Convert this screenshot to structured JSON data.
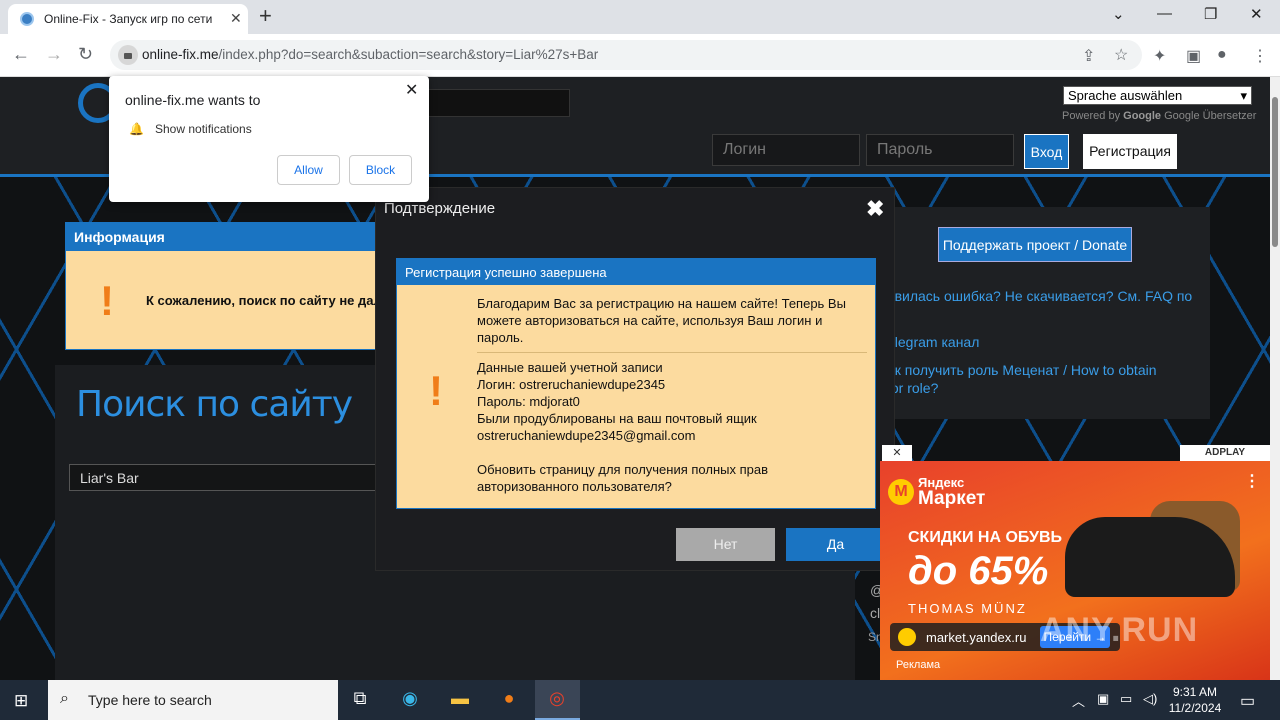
{
  "browser": {
    "tab_title": "Online-Fix - Запуск игр по сети",
    "tab_close": "✕",
    "new_tab": "+",
    "url_host": "online-fix.me",
    "url_rest": "/index.php?do=search&subaction=search&story=Liar%27s+Bar"
  },
  "header": {
    "lang_select": "Sprache auswählen",
    "powered_prefix": "Powered by",
    "powered_google": "Google",
    "powered_suffix": "Google Übersetzer",
    "login_placeholder": "Логин",
    "password_placeholder": "Пароль",
    "enter_label": "Вход",
    "register_label": "Регистрация"
  },
  "info": {
    "header": "Информация",
    "message": "К сожалению, поиск по сайту не дал"
  },
  "search": {
    "title": "Поиск по сайту",
    "query": "Liar's Bar"
  },
  "sidebar": {
    "donate": "Поддержать проект / Donate",
    "links": [
      "явилась ошибка? Не скачивается? См. FAQ по",
      "elegram канал",
      "ак получить роль Меценат / How to obtain",
      "tor role?"
    ],
    "frag1": "@",
    "frag2": "cl",
    "frag3": "Sn"
  },
  "modal": {
    "title": "Подтверждение",
    "box_header": "Регистрация успешно завершена",
    "thanks": "Благодарим Вас за регистрацию на нашем сайте! Теперь Вы можете авторизоваться на сайте, используя Ваш логин и пароль.",
    "account_title": "Данные вашей учетной записи",
    "login_line": "Логин: ostreruchaniewdupe2345",
    "password_line": "Пароль: mdjorat0",
    "duplicated_line": "Были продублированы на ваш почтовый ящик",
    "email_line": "ostreruchaniewdupe2345@gmail.com",
    "refresh_question": "Обновить страницу для получения полных прав авторизованного пользователя?",
    "no_label": "Нет",
    "yes_label": "Да"
  },
  "notification": {
    "title": "online-fix.me wants to",
    "line": "Show notifications",
    "allow": "Allow",
    "block": "Block"
  },
  "ad": {
    "adplay": "ADPLAY",
    "brand_top": "Яндекс",
    "brand_bottom": "Маркет",
    "promo_line1": "СКИДКИ НА ОБУВЬ",
    "promo_line2": "до 65%",
    "brand_shoe": "THOMAS MÜNZ",
    "site": "market.yandex.ru",
    "go": "Перейти →",
    "label": "Реклама",
    "watermark": "ANY.RUN"
  },
  "taskbar": {
    "search_placeholder": "Type here to search",
    "time": "9:31 AM",
    "date": "11/2/2024"
  }
}
